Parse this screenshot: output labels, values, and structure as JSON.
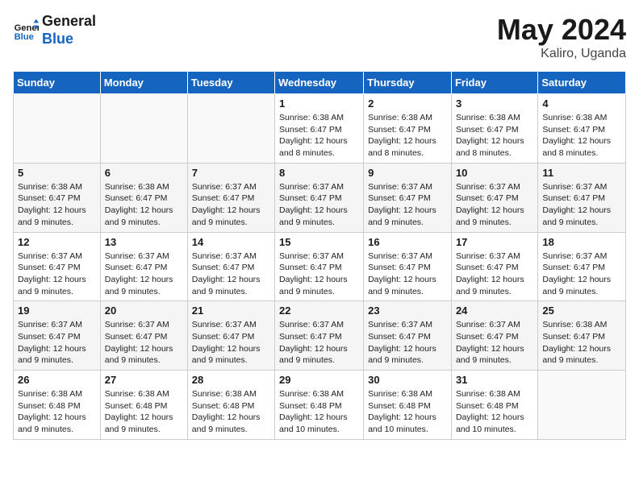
{
  "header": {
    "logo_line1": "General",
    "logo_line2": "Blue",
    "month_title": "May 2024",
    "location": "Kaliro, Uganda"
  },
  "days_of_week": [
    "Sunday",
    "Monday",
    "Tuesday",
    "Wednesday",
    "Thursday",
    "Friday",
    "Saturday"
  ],
  "weeks": [
    [
      {
        "day": "",
        "info": ""
      },
      {
        "day": "",
        "info": ""
      },
      {
        "day": "",
        "info": ""
      },
      {
        "day": "1",
        "info": "Sunrise: 6:38 AM\nSunset: 6:47 PM\nDaylight: 12 hours\nand 8 minutes."
      },
      {
        "day": "2",
        "info": "Sunrise: 6:38 AM\nSunset: 6:47 PM\nDaylight: 12 hours\nand 8 minutes."
      },
      {
        "day": "3",
        "info": "Sunrise: 6:38 AM\nSunset: 6:47 PM\nDaylight: 12 hours\nand 8 minutes."
      },
      {
        "day": "4",
        "info": "Sunrise: 6:38 AM\nSunset: 6:47 PM\nDaylight: 12 hours\nand 8 minutes."
      }
    ],
    [
      {
        "day": "5",
        "info": "Sunrise: 6:38 AM\nSunset: 6:47 PM\nDaylight: 12 hours\nand 9 minutes."
      },
      {
        "day": "6",
        "info": "Sunrise: 6:38 AM\nSunset: 6:47 PM\nDaylight: 12 hours\nand 9 minutes."
      },
      {
        "day": "7",
        "info": "Sunrise: 6:37 AM\nSunset: 6:47 PM\nDaylight: 12 hours\nand 9 minutes."
      },
      {
        "day": "8",
        "info": "Sunrise: 6:37 AM\nSunset: 6:47 PM\nDaylight: 12 hours\nand 9 minutes."
      },
      {
        "day": "9",
        "info": "Sunrise: 6:37 AM\nSunset: 6:47 PM\nDaylight: 12 hours\nand 9 minutes."
      },
      {
        "day": "10",
        "info": "Sunrise: 6:37 AM\nSunset: 6:47 PM\nDaylight: 12 hours\nand 9 minutes."
      },
      {
        "day": "11",
        "info": "Sunrise: 6:37 AM\nSunset: 6:47 PM\nDaylight: 12 hours\nand 9 minutes."
      }
    ],
    [
      {
        "day": "12",
        "info": "Sunrise: 6:37 AM\nSunset: 6:47 PM\nDaylight: 12 hours\nand 9 minutes."
      },
      {
        "day": "13",
        "info": "Sunrise: 6:37 AM\nSunset: 6:47 PM\nDaylight: 12 hours\nand 9 minutes."
      },
      {
        "day": "14",
        "info": "Sunrise: 6:37 AM\nSunset: 6:47 PM\nDaylight: 12 hours\nand 9 minutes."
      },
      {
        "day": "15",
        "info": "Sunrise: 6:37 AM\nSunset: 6:47 PM\nDaylight: 12 hours\nand 9 minutes."
      },
      {
        "day": "16",
        "info": "Sunrise: 6:37 AM\nSunset: 6:47 PM\nDaylight: 12 hours\nand 9 minutes."
      },
      {
        "day": "17",
        "info": "Sunrise: 6:37 AM\nSunset: 6:47 PM\nDaylight: 12 hours\nand 9 minutes."
      },
      {
        "day": "18",
        "info": "Sunrise: 6:37 AM\nSunset: 6:47 PM\nDaylight: 12 hours\nand 9 minutes."
      }
    ],
    [
      {
        "day": "19",
        "info": "Sunrise: 6:37 AM\nSunset: 6:47 PM\nDaylight: 12 hours\nand 9 minutes."
      },
      {
        "day": "20",
        "info": "Sunrise: 6:37 AM\nSunset: 6:47 PM\nDaylight: 12 hours\nand 9 minutes."
      },
      {
        "day": "21",
        "info": "Sunrise: 6:37 AM\nSunset: 6:47 PM\nDaylight: 12 hours\nand 9 minutes."
      },
      {
        "day": "22",
        "info": "Sunrise: 6:37 AM\nSunset: 6:47 PM\nDaylight: 12 hours\nand 9 minutes."
      },
      {
        "day": "23",
        "info": "Sunrise: 6:37 AM\nSunset: 6:47 PM\nDaylight: 12 hours\nand 9 minutes."
      },
      {
        "day": "24",
        "info": "Sunrise: 6:37 AM\nSunset: 6:47 PM\nDaylight: 12 hours\nand 9 minutes."
      },
      {
        "day": "25",
        "info": "Sunrise: 6:38 AM\nSunset: 6:47 PM\nDaylight: 12 hours\nand 9 minutes."
      }
    ],
    [
      {
        "day": "26",
        "info": "Sunrise: 6:38 AM\nSunset: 6:48 PM\nDaylight: 12 hours\nand 9 minutes."
      },
      {
        "day": "27",
        "info": "Sunrise: 6:38 AM\nSunset: 6:48 PM\nDaylight: 12 hours\nand 9 minutes."
      },
      {
        "day": "28",
        "info": "Sunrise: 6:38 AM\nSunset: 6:48 PM\nDaylight: 12 hours\nand 9 minutes."
      },
      {
        "day": "29",
        "info": "Sunrise: 6:38 AM\nSunset: 6:48 PM\nDaylight: 12 hours\nand 10 minutes."
      },
      {
        "day": "30",
        "info": "Sunrise: 6:38 AM\nSunset: 6:48 PM\nDaylight: 12 hours\nand 10 minutes."
      },
      {
        "day": "31",
        "info": "Sunrise: 6:38 AM\nSunset: 6:48 PM\nDaylight: 12 hours\nand 10 minutes."
      },
      {
        "day": "",
        "info": ""
      }
    ]
  ]
}
